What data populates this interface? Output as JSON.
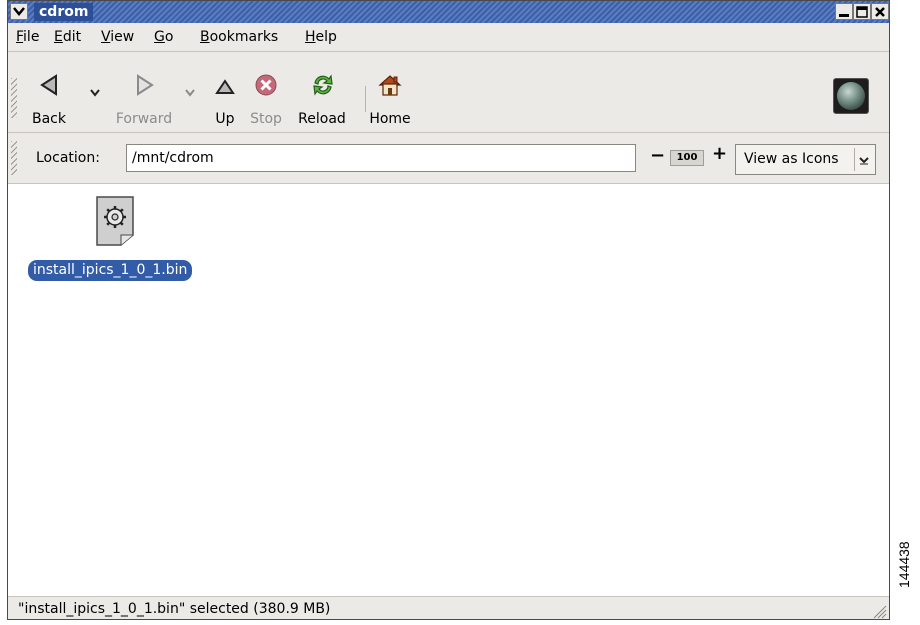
{
  "window": {
    "title": "cdrom"
  },
  "menubar": {
    "items": [
      {
        "mnemonic": "F",
        "rest": "ile"
      },
      {
        "mnemonic": "E",
        "rest": "dit"
      },
      {
        "mnemonic": "V",
        "rest": "iew"
      },
      {
        "mnemonic": "G",
        "rest": "o"
      },
      {
        "mnemonic": "B",
        "rest": "ookmarks"
      },
      {
        "mnemonic": "H",
        "rest": "elp"
      }
    ]
  },
  "toolbar": {
    "back_label": "Back",
    "forward_label": "Forward",
    "up_label": "Up",
    "stop_label": "Stop",
    "reload_label": "Reload",
    "home_label": "Home"
  },
  "location": {
    "label": "Location:",
    "value": "/mnt/cdrom",
    "zoom": "100",
    "zoom_minus": "−",
    "zoom_plus": "+",
    "view_mode": "View as Icons"
  },
  "files": [
    {
      "name": "install_ipics_1_0_1.bin",
      "icon": "gear-document-icon",
      "selected": true
    }
  ],
  "status": {
    "text": "\"install_ipics_1_0_1.bin\" selected (380.9 MB)"
  },
  "figure_number": "144438",
  "colors": {
    "titlebar": "#3d5fa6",
    "selection": "#335ca8",
    "window_bg": "#eceae6"
  }
}
